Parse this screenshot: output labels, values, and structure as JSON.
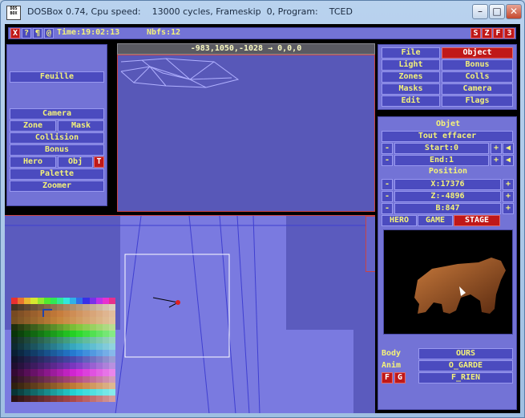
{
  "window": {
    "title": "DOSBox 0.74, Cpu speed:    13000 cycles, Frameskip  0, Program:    TCED",
    "icon_label": "DOS BOX"
  },
  "status": {
    "icons": [
      "X",
      "?",
      "¶",
      "@"
    ],
    "time": "Time:19:02:13",
    "nbfs": "Nbfs:12",
    "right": [
      "S",
      "Z",
      "F",
      "3"
    ]
  },
  "coords": "-983,1050,-1028 → 0,0,0",
  "left_menu": {
    "feuille": "Feuille",
    "camera": "Camera",
    "zone": "Zone",
    "mask": "Mask",
    "collision": "Collision",
    "bonus": "Bonus",
    "hero": "Hero",
    "obj": "Obj",
    "t": "T",
    "palette": "Palette",
    "zoomer": "Zoomer"
  },
  "right_menu": {
    "file": "File",
    "object": "Object",
    "light": "Light",
    "bonus": "Bonus",
    "zones": "Zones",
    "colls": "Colls",
    "masks": "Masks",
    "camera": "Camera",
    "edit": "Edit",
    "flags": "Flags"
  },
  "object_panel": {
    "title": "Objet",
    "clear": "Tout effacer",
    "start": "Start:0",
    "end": "End:1",
    "position": "Position",
    "x": "X:17376",
    "z": "Z:-4896",
    "b": "B:847",
    "minus": "-",
    "plus": "+",
    "tabs": {
      "hero": "HERO",
      "game": "GAME",
      "stage": "STAGE"
    },
    "body_label": "Body",
    "body_value": "OURS",
    "anim_label": "Anim",
    "anim_value": "O_GARDE",
    "f": "F",
    "g": "G",
    "f_value": "F_RIEN"
  }
}
